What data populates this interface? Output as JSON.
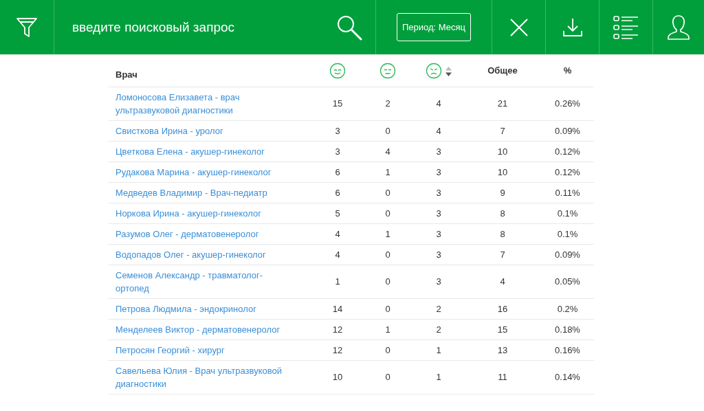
{
  "search": {
    "placeholder": "введите поисковый запрос"
  },
  "period_button": "Период: Месяц",
  "table": {
    "columns": [
      {
        "kind": "text",
        "label": "Врач"
      },
      {
        "kind": "happy"
      },
      {
        "kind": "neutral"
      },
      {
        "kind": "sad",
        "sorted_descending": true
      },
      {
        "kind": "text",
        "label": "Общее"
      },
      {
        "kind": "text",
        "label": "%"
      }
    ],
    "rows": [
      [
        "Ломоносова Елизавета - врач ультразвуковой диагностики",
        "15",
        "2",
        "4",
        "21",
        "0.26%"
      ],
      [
        "Свисткова Ирина - уролог",
        "3",
        "0",
        "4",
        "7",
        "0.09%"
      ],
      [
        "Цветкова Елена - акушер-гинеколог",
        "3",
        "4",
        "3",
        "10",
        "0.12%"
      ],
      [
        "Рудакова Марина - акушер-гинеколог",
        "6",
        "1",
        "3",
        "10",
        "0.12%"
      ],
      [
        "Медведев Владимир - Врач-педиатр",
        "6",
        "0",
        "3",
        "9",
        "0.11%"
      ],
      [
        "Норкова Ирина - акушер-гинеколог",
        "5",
        "0",
        "3",
        "8",
        "0.1%"
      ],
      [
        "Разумов Олег - дерматовенеролог",
        "4",
        "1",
        "3",
        "8",
        "0.1%"
      ],
      [
        "Водопадов Олег - акушер-гинеколог",
        "4",
        "0",
        "3",
        "7",
        "0.09%"
      ],
      [
        "Семенов Александр - травматолог-ортопед",
        "1",
        "0",
        "3",
        "4",
        "0.05%"
      ],
      [
        "Петрова Людмила - эндокринолог",
        "14",
        "0",
        "2",
        "16",
        "0.2%"
      ],
      [
        "Менделеев Виктор - дерматовенеролог",
        "12",
        "1",
        "2",
        "15",
        "0.18%"
      ],
      [
        "Петросян Георгий - хирург",
        "12",
        "0",
        "1",
        "13",
        "0.16%"
      ],
      [
        "Савельева Юлия - Врач ультразвуковой диагностики",
        "10",
        "0",
        "1",
        "11",
        "0.14%"
      ]
    ]
  }
}
